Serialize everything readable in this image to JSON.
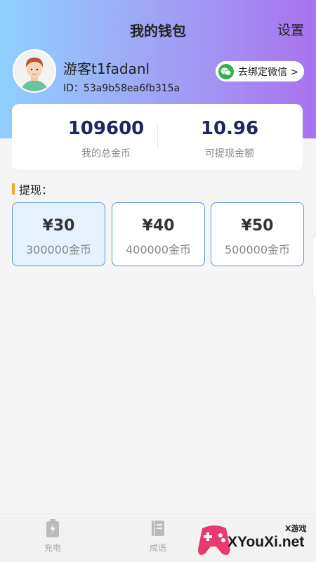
{
  "header": {
    "title": "我的钱包",
    "settings_label": "设置"
  },
  "user": {
    "name": "游客t1fadanl",
    "id": "ID：53a9b58ea6fb315a",
    "wechat_button": "去绑定微信 >"
  },
  "stats": {
    "total_coins": "109600",
    "total_coins_label": "我的总金币",
    "withdrawable": "10.96",
    "withdrawable_label": "可提现金额"
  },
  "withdraw": {
    "section_title": "提现：",
    "options": [
      {
        "price": "¥30",
        "coins": "300000金币",
        "selected": true
      },
      {
        "price": "¥40",
        "coins": "400000金币",
        "selected": false
      },
      {
        "price": "¥50",
        "coins": "500000金币",
        "selected": false
      }
    ]
  },
  "nav": {
    "items": [
      {
        "label": "充电",
        "icon": "battery-icon"
      },
      {
        "label": "成语",
        "icon": "book-icon"
      }
    ]
  },
  "watermark": {
    "brand": "XYouXi.net",
    "small": "X游戏"
  },
  "colors": {
    "gradient_start": "#8fd0ff",
    "gradient_end": "#a873ee",
    "stat_value": "#1c2763",
    "option_border": "#5b95d4",
    "option_selected_bg": "#e5f1ff",
    "accent_bar": "#f5a623",
    "wechat_green": "#2db44a"
  }
}
